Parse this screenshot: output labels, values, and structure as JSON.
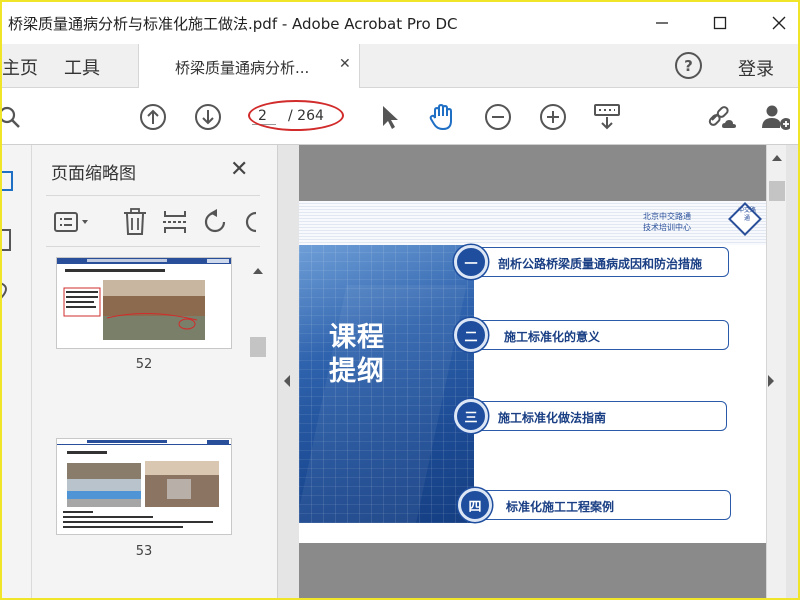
{
  "window": {
    "title": "桥梁质量通病分析与标准化施工做法.pdf - Adobe Acrobat Pro DC"
  },
  "nav": {
    "home_label": "主页",
    "tools_label": "工具",
    "tab_label": "桥梁质量通病分析...",
    "help_label": "?",
    "login_label": "登录"
  },
  "toolbar": {
    "current_page": "2",
    "total_pages": "/ 264",
    "icons": [
      "search-icon",
      "page-up-icon",
      "page-down-icon",
      "select-cursor-icon",
      "hand-tool-icon",
      "zoom-out-icon",
      "zoom-in-icon",
      "keyboard-tool-icon",
      "share-link-icon",
      "add-user-icon"
    ],
    "highlight_color": "#d22b2b"
  },
  "thumbnails_panel": {
    "title": "页面缩略图",
    "close_label": "✕",
    "pages": [
      {
        "number": "52",
        "header": "剖析公路桥梁质量通病成因和防治措施",
        "subtitle": "1、 高墩方案台板保护墙质量问题预治"
      },
      {
        "number": "53",
        "header": "剖析公路桥梁质量通病成因和防治措施",
        "subtitle": "1、 质量措施"
      }
    ]
  },
  "slide": {
    "org_line1": "北京中交路通",
    "org_line2": "技术培训中心",
    "logo_text": "中交路通",
    "title": "课程提纲",
    "outline": [
      {
        "badge": "一",
        "text": "剖析公路桥梁质量通病成因和防治措施"
      },
      {
        "badge": "二",
        "text": "施工标准化的意义"
      },
      {
        "badge": "三",
        "text": "施工标准化做法指南"
      },
      {
        "badge": "四",
        "text": "标准化施工工程案例"
      }
    ]
  },
  "colors": {
    "accent": "#1f4e9e",
    "border_frame": "#f1e52a",
    "page_background": "#8a8a8a"
  }
}
